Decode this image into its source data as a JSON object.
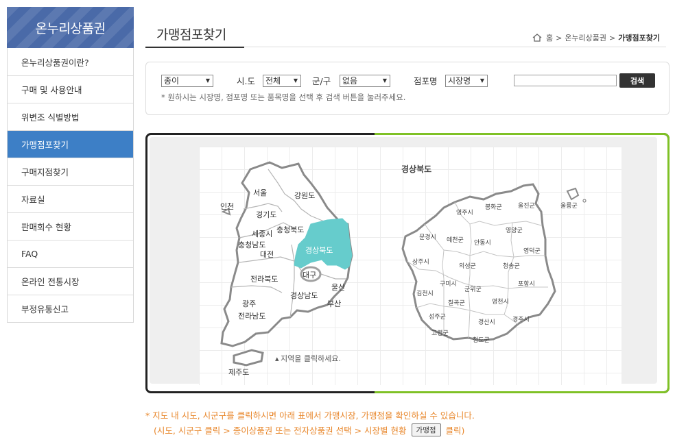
{
  "sidebar": {
    "title": "온누리상품권",
    "items": [
      {
        "label": "온누리상품권이란?"
      },
      {
        "label": "구매 및 사용안내"
      },
      {
        "label": "위변조 식별방법"
      },
      {
        "label": "가맹점포찾기"
      },
      {
        "label": "구매지점찾기"
      },
      {
        "label": "자료실"
      },
      {
        "label": "판매회수 현황"
      },
      {
        "label": "FAQ"
      },
      {
        "label": "온라인 전통시장"
      },
      {
        "label": "부정유통신고"
      }
    ],
    "active_index": 3,
    "colors": {
      "header": "#4a6aa8",
      "active": "#3d7fc6"
    }
  },
  "header": {
    "title": "가맹점포찾기",
    "breadcrumb": [
      "홈",
      "온누리상품권",
      "가맹점포찾기"
    ],
    "home_icon": "home-icon"
  },
  "search": {
    "type_select": "종이",
    "sido_label": "시.도",
    "sido_select": "전체",
    "gungu_label": "군/구",
    "gungu_select": "없음",
    "store_label": "점포명",
    "store_select": "시장명",
    "query_value": "",
    "button": "검색",
    "hint": "* 원하시는 시장명, 점포명 또는 품목명을 선택 후 검색 버튼을 눌러주세요."
  },
  "map": {
    "highlight_color": "#66cccc",
    "frame_accent": "#7fc126",
    "korea_labels": [
      "서울",
      "인천",
      "강원도",
      "경기도",
      "충청북도",
      "세종시",
      "충청남도",
      "대전",
      "경상북도",
      "대구",
      "전라북도",
      "울산",
      "경상남도",
      "광주",
      "부산",
      "전라남도",
      "제주도"
    ],
    "prompt": "지역을 클릭하세요.",
    "region_title": "경상북도",
    "region_labels": [
      "영주시",
      "봉화군",
      "울진군",
      "울릉군",
      "영양군",
      "문경시",
      "예천군",
      "안동시",
      "영덕군",
      "상주시",
      "의성군",
      "청송군",
      "구미시",
      "포항시",
      "김천시",
      "군위군",
      "칠곡군",
      "영천시",
      "성주군",
      "경산시",
      "경주시",
      "고령군",
      "청도군"
    ],
    "highlighted_region": "경상북도"
  },
  "notes": {
    "line1": "* 지도 내 시도, 시군구를 클릭하시면 아래 표에서 가맹시장, 가맹점을 확인하실 수 있습니다.",
    "line2_pre": "(시도, 시군구 클릭 > 종이상품권 또는 전자상품권 선택 > 시장별 현황",
    "button": "가맹점",
    "line2_post": "클릭)",
    "color": "#e8862a"
  }
}
